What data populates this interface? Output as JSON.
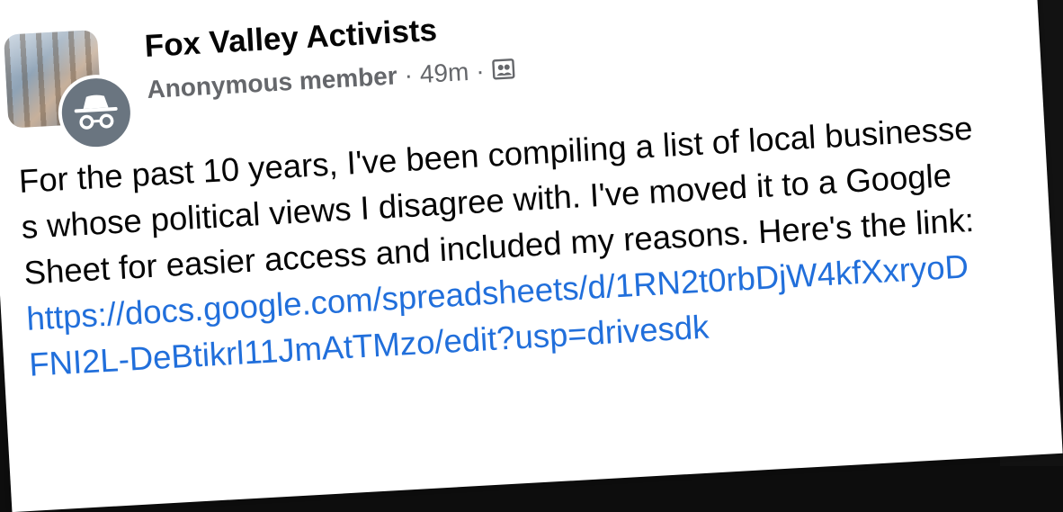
{
  "post": {
    "group_name": "Fox Valley Activists",
    "author": "Anonymous member",
    "separator": "·",
    "time": "49m",
    "text": "For the past 10 years, I've been compiling a list of local businesses whose political views I disagree with. I've moved it to a Google Sheet for easier access and included my reasons. Here's the link: ",
    "link": "https://docs.google.com/spreadsheets/d/1RN2t0rbDjW4kfXxryoDFNI2L-DeBtikrl11JmAtTMzo/edit?usp=drivesdk"
  },
  "icons": {
    "avatar": "anonymous-incognito-icon",
    "privacy": "group-members-icon",
    "more": "more-horizontal-icon",
    "close": "close-icon"
  },
  "colors": {
    "text": "#050505",
    "meta": "#65676b",
    "link": "#216fdb",
    "avatar_bg": "#6a7580"
  }
}
